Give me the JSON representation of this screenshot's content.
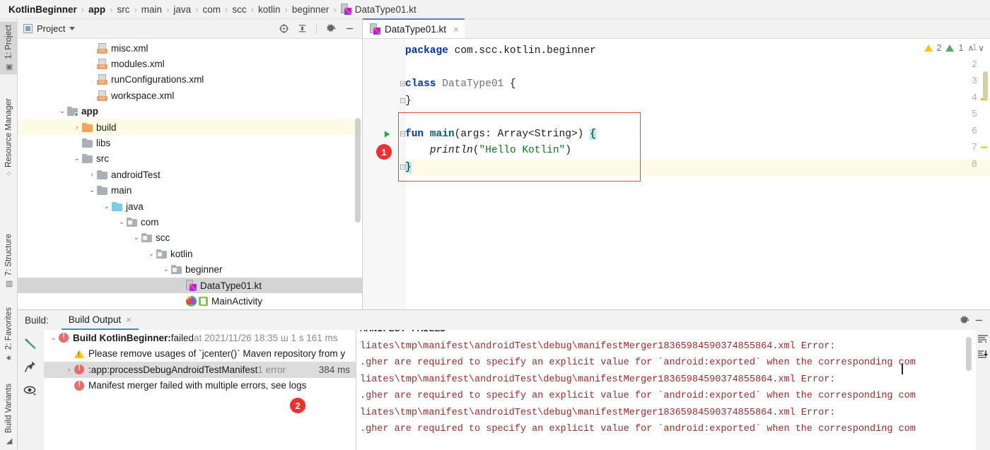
{
  "breadcrumb": {
    "items": [
      {
        "label": "KotlinBeginner",
        "bold": true
      },
      {
        "label": "app",
        "bold": true
      },
      {
        "label": "src",
        "bold": false
      },
      {
        "label": "main",
        "bold": false
      },
      {
        "label": "java",
        "bold": false
      },
      {
        "label": "com",
        "bold": false
      },
      {
        "label": "scc",
        "bold": false
      },
      {
        "label": "kotlin",
        "bold": false
      },
      {
        "label": "beginner",
        "bold": false
      }
    ],
    "file": "DataType01.kt",
    "separator": "›"
  },
  "toolstrip": {
    "items": [
      {
        "label": "1: Project",
        "icon": "project-icon",
        "active": true
      },
      {
        "label": "Resource Manager",
        "icon": "resource-manager-icon",
        "active": false
      },
      {
        "label": "7: Structure",
        "icon": "structure-icon",
        "active": false
      },
      {
        "label": "2: Favorites",
        "icon": "star-icon",
        "active": false
      },
      {
        "label": "Build Variants",
        "icon": "build-variants-icon",
        "active": false
      }
    ]
  },
  "project_panel": {
    "title": "Project",
    "toolbar": [
      "locate-icon",
      "collapse-all-icon",
      "gear-icon",
      "minimize-icon"
    ],
    "tree": [
      {
        "label": "misc.xml",
        "indent": 4,
        "icon": "xml",
        "twist": "",
        "state": "normal"
      },
      {
        "label": "modules.xml",
        "indent": 4,
        "icon": "xml",
        "twist": "",
        "state": "normal"
      },
      {
        "label": "runConfigurations.xml",
        "indent": 4,
        "icon": "xml",
        "twist": "",
        "state": "normal"
      },
      {
        "label": "workspace.xml",
        "indent": 4,
        "icon": "xml",
        "twist": "",
        "state": "normal"
      },
      {
        "label": "app",
        "indent": 2,
        "icon": "folder-grey-module",
        "twist": "⌄",
        "state": "bold"
      },
      {
        "label": "build",
        "indent": 3,
        "icon": "folder-orange",
        "twist": "›",
        "state": "highlight"
      },
      {
        "label": "libs",
        "indent": 3,
        "icon": "folder-grey",
        "twist": "",
        "state": "normal"
      },
      {
        "label": "src",
        "indent": 3,
        "icon": "folder-grey",
        "twist": "⌄",
        "state": "normal"
      },
      {
        "label": "androidTest",
        "indent": 4,
        "icon": "folder-grey",
        "twist": "›",
        "state": "normal"
      },
      {
        "label": "main",
        "indent": 4,
        "icon": "folder-grey",
        "twist": "⌄",
        "state": "normal"
      },
      {
        "label": "java",
        "indent": 5,
        "icon": "folder-blue",
        "twist": "⌄",
        "state": "normal"
      },
      {
        "label": "com",
        "indent": 6,
        "icon": "folder-pkg",
        "twist": "⌄",
        "state": "normal"
      },
      {
        "label": "scc",
        "indent": 7,
        "icon": "folder-pkg",
        "twist": "⌄",
        "state": "normal"
      },
      {
        "label": "kotlin",
        "indent": 8,
        "icon": "folder-pkg",
        "twist": "⌄",
        "state": "normal"
      },
      {
        "label": "beginner",
        "indent": 9,
        "icon": "folder-pkg",
        "twist": "⌄",
        "state": "normal"
      },
      {
        "label": "DataType01.kt",
        "indent": 10,
        "icon": "kotlin",
        "twist": "",
        "state": "selected"
      },
      {
        "label": "MainActivity",
        "indent": 10,
        "icon": "android-activity",
        "twist": "",
        "state": "normal"
      }
    ]
  },
  "editor": {
    "tab": {
      "label": "DataType01.kt",
      "close": "×"
    },
    "line_numbers": [
      "1",
      "2",
      "3",
      "4",
      "5",
      "6",
      "7",
      "8"
    ],
    "code": [
      {
        "n": 1,
        "tokens": [
          {
            "t": "package",
            "c": "kw"
          },
          {
            "t": " com.scc.kotlin.beginner",
            "c": "pln"
          }
        ]
      },
      {
        "n": 2,
        "tokens": []
      },
      {
        "n": 3,
        "tokens": [
          {
            "t": "class",
            "c": "kw"
          },
          {
            "t": " ",
            "c": "pln"
          },
          {
            "t": "DataType01",
            "c": "cls"
          },
          {
            "t": " {",
            "c": "pln"
          }
        ]
      },
      {
        "n": 4,
        "tokens": [
          {
            "t": "}",
            "c": "pln"
          }
        ]
      },
      {
        "n": 5,
        "tokens": []
      },
      {
        "n": 6,
        "tokens": [
          {
            "t": "fun",
            "c": "kw"
          },
          {
            "t": " ",
            "c": "pln"
          },
          {
            "t": "main",
            "c": "fn"
          },
          {
            "t": "(args: Array<String>) ",
            "c": "pln"
          },
          {
            "t": "{",
            "c": "brhl"
          }
        ]
      },
      {
        "n": 7,
        "tokens": [
          {
            "t": "    ",
            "c": "pln"
          },
          {
            "t": "println",
            "c": "italic"
          },
          {
            "t": "(",
            "c": "pln"
          },
          {
            "t": "\"Hello Kotlin\"",
            "c": "str"
          },
          {
            "t": ")",
            "c": "pln"
          }
        ]
      },
      {
        "n": 8,
        "tokens": [
          {
            "t": "}",
            "c": "brhl"
          }
        ]
      }
    ],
    "inspections": {
      "warning_count": "2",
      "weak_warning_count": "1",
      "up": "∧",
      "down": "∨"
    },
    "annotation_badge": "1"
  },
  "build_panel": {
    "label": "Build:",
    "tab": {
      "label": "Build Output",
      "close": "×"
    },
    "side_icons": [
      "build-hammer-icon",
      "pin-icon",
      "eye-icon"
    ],
    "toolbar_right": [
      "gear-icon",
      "minimize-icon"
    ],
    "log_toolbar": [
      "soft-wrap-icon",
      "scroll-to-end-icon"
    ],
    "annotation_badge": "2",
    "tree": [
      {
        "indent": 0,
        "twist": "⌄",
        "icon": "error",
        "parts": [
          {
            "t": "Build KotlinBeginner:",
            "c": "bold"
          },
          {
            "t": " failed",
            "c": ""
          },
          {
            "t": " at 2021/11/26 18:35 ш 1 s 161 ms",
            "c": "dim"
          }
        ],
        "selected": false,
        "right": ""
      },
      {
        "indent": 1,
        "twist": "",
        "icon": "warning",
        "parts": [
          {
            "t": "Please remove usages of `jcenter()` Maven repository from y",
            "c": ""
          }
        ],
        "selected": false,
        "right": ""
      },
      {
        "indent": 1,
        "twist": "›",
        "icon": "error",
        "parts": [
          {
            "t": ":app:processDebugAndroidTestManifest",
            "c": ""
          },
          {
            "t": "  1 error",
            "c": "dim"
          }
        ],
        "selected": true,
        "right": "384 ms"
      },
      {
        "indent": 1,
        "twist": "",
        "icon": "error",
        "parts": [
          {
            "t": "Manifest merger failed with multiple errors, see logs",
            "c": ""
          }
        ],
        "selected": false,
        "right": ""
      }
    ],
    "log_lines": [
      {
        "text": "MANIFEST FAILED",
        "dark": true
      },
      {
        "text": "liates\\tmp\\manifest\\androidTest\\debug\\manifestMerger18365984590374855864.xml Error:",
        "dark": false
      },
      {
        "text": ".gher are required to specify an explicit value for `android:exported` when the corresponding com",
        "dark": false
      },
      {
        "text": "liates\\tmp\\manifest\\androidTest\\debug\\manifestMerger18365984590374855864.xml Error:",
        "dark": false
      },
      {
        "text": ".gher are required to specify an explicit value for `android:exported` when the corresponding com",
        "dark": false
      },
      {
        "text": "liates\\tmp\\manifest\\androidTest\\debug\\manifestMerger18365984590374855864.xml Error:",
        "dark": false
      },
      {
        "text": ".gher are required to specify an explicit value for `android:exported` when the corresponding com",
        "dark": false
      }
    ]
  },
  "colors": {
    "accent": "#4a88c7",
    "error": "#ec6a6a",
    "warning": "#f5c518",
    "badge": "#f02f2f",
    "keyword": "#0033b3",
    "string": "#067d17"
  }
}
